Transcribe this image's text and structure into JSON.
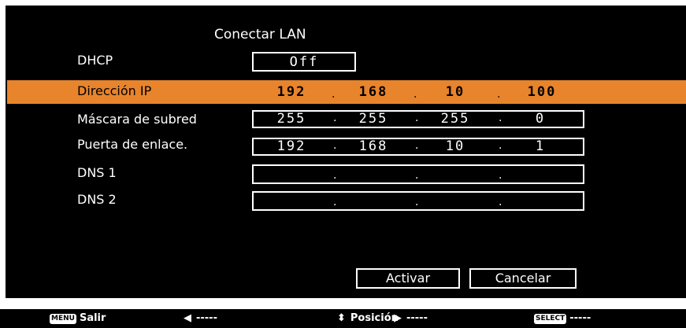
{
  "title": "Conectar LAN",
  "dhcp": {
    "label": "DHCP",
    "value": "Off"
  },
  "fields": [
    {
      "label": "Dirección IP",
      "octets": [
        "192",
        "168",
        "10",
        "100"
      ],
      "selected": true
    },
    {
      "label": "Máscara de subred",
      "octets": [
        "255",
        "255",
        "255",
        "0"
      ]
    },
    {
      "label": "Puerta de enlace.",
      "octets": [
        "192",
        "168",
        "10",
        "1"
      ]
    },
    {
      "label": "DNS 1",
      "octets": [
        "",
        "",
        "",
        ""
      ]
    },
    {
      "label": "DNS 2",
      "octets": [
        "",
        "",
        "",
        ""
      ]
    }
  ],
  "buttons": {
    "activate": "Activar",
    "cancel": "Cancelar"
  },
  "footer": {
    "menu_key": "MENU",
    "menu_label": "Salir",
    "left_label": "-----",
    "updown_label": "Posición",
    "right_label": "-----",
    "select_key": "SELECT",
    "select_label": "-----"
  },
  "colors": {
    "highlight": "#e8842b",
    "panel": "#000000",
    "text": "#ffffff"
  }
}
